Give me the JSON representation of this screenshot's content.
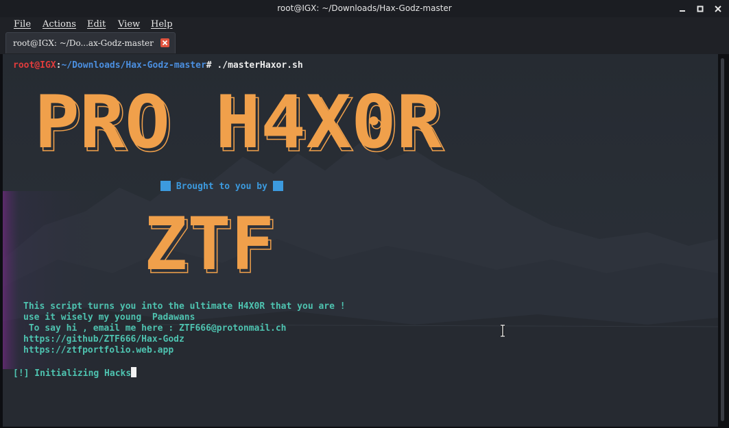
{
  "window": {
    "title": "root@IGX: ~/Downloads/Hax-Godz-master",
    "controls": [
      "minimize-icon",
      "maximize-icon",
      "close-icon"
    ]
  },
  "menu": {
    "items": [
      "File",
      "Actions",
      "Edit",
      "View",
      "Help"
    ]
  },
  "tab": {
    "label": "root@IGX: ~/Do...ax-Godz-master",
    "close_icon": "close-icon"
  },
  "terminal": {
    "prompt_user": "root@IGX",
    "prompt_colon": ":",
    "prompt_path": "~/Downloads/Hax-Godz-master",
    "prompt_symbol": "#",
    "command": " ./masterHaxor.sh",
    "banner_title": "PRO H4X0R",
    "brought_by": " Brought to you by ",
    "banner_author": "ZTF",
    "info_lines": [
      "This script turns you into the ultimate H4X0R that you are !",
      "use it wisely my young  Padawans",
      " To say hi , email me here : ZTF666@protonmail.ch",
      "https://github/ZTF666/Hax-Godz",
      "https://ztfportfolio.web.app"
    ],
    "status_line": "[!] Initializing Hacks"
  },
  "colors": {
    "prompt_user": "#e13c3c",
    "prompt_path": "#4b8fe0",
    "banner_fill": "#f0a04b",
    "info_text": "#4ec3b0",
    "brought_by": "#3c9ade",
    "tab_close": "#e0533e"
  }
}
